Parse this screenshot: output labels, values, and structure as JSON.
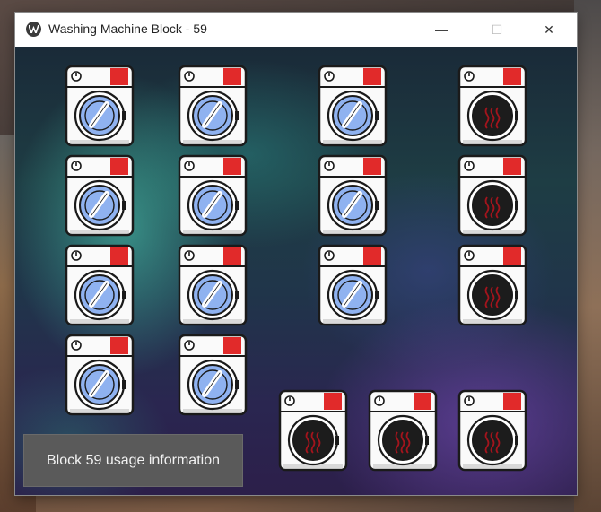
{
  "window": {
    "title": "Washing Machine Block - 59",
    "controls": {
      "minimize": "—",
      "maximize": "☐",
      "close": "✕"
    }
  },
  "machines": [
    {
      "status": "idle",
      "icon": "washer-idle-icon"
    },
    {
      "status": "idle",
      "icon": "washer-idle-icon"
    },
    {
      "status": "idle",
      "icon": "washer-idle-icon"
    },
    {
      "status": "in-use",
      "icon": "washer-in-use-icon"
    },
    {
      "status": "idle",
      "icon": "washer-idle-icon"
    },
    {
      "status": "idle",
      "icon": "washer-idle-icon"
    },
    {
      "status": "idle",
      "icon": "washer-idle-icon"
    },
    {
      "status": "in-use",
      "icon": "washer-in-use-icon"
    },
    {
      "status": "idle",
      "icon": "washer-idle-icon"
    },
    {
      "status": "idle",
      "icon": "washer-idle-icon"
    },
    {
      "status": "idle",
      "icon": "washer-idle-icon"
    },
    {
      "status": "in-use",
      "icon": "washer-in-use-icon"
    },
    {
      "status": "idle",
      "icon": "washer-idle-icon"
    },
    {
      "status": "idle",
      "icon": "washer-idle-icon"
    },
    {
      "status": "in-use",
      "icon": "washer-in-use-icon"
    },
    {
      "status": "in-use",
      "icon": "washer-in-use-icon"
    },
    {
      "status": "in-use",
      "icon": "washer-in-use-icon"
    }
  ],
  "info_button": {
    "label": "Block 59 usage information"
  },
  "colors": {
    "indicator_red": "#e12a2a",
    "drum_blue": "#8fb2f0",
    "drum_dark": "#1c1c1c",
    "heat_red": "#a3141c"
  }
}
